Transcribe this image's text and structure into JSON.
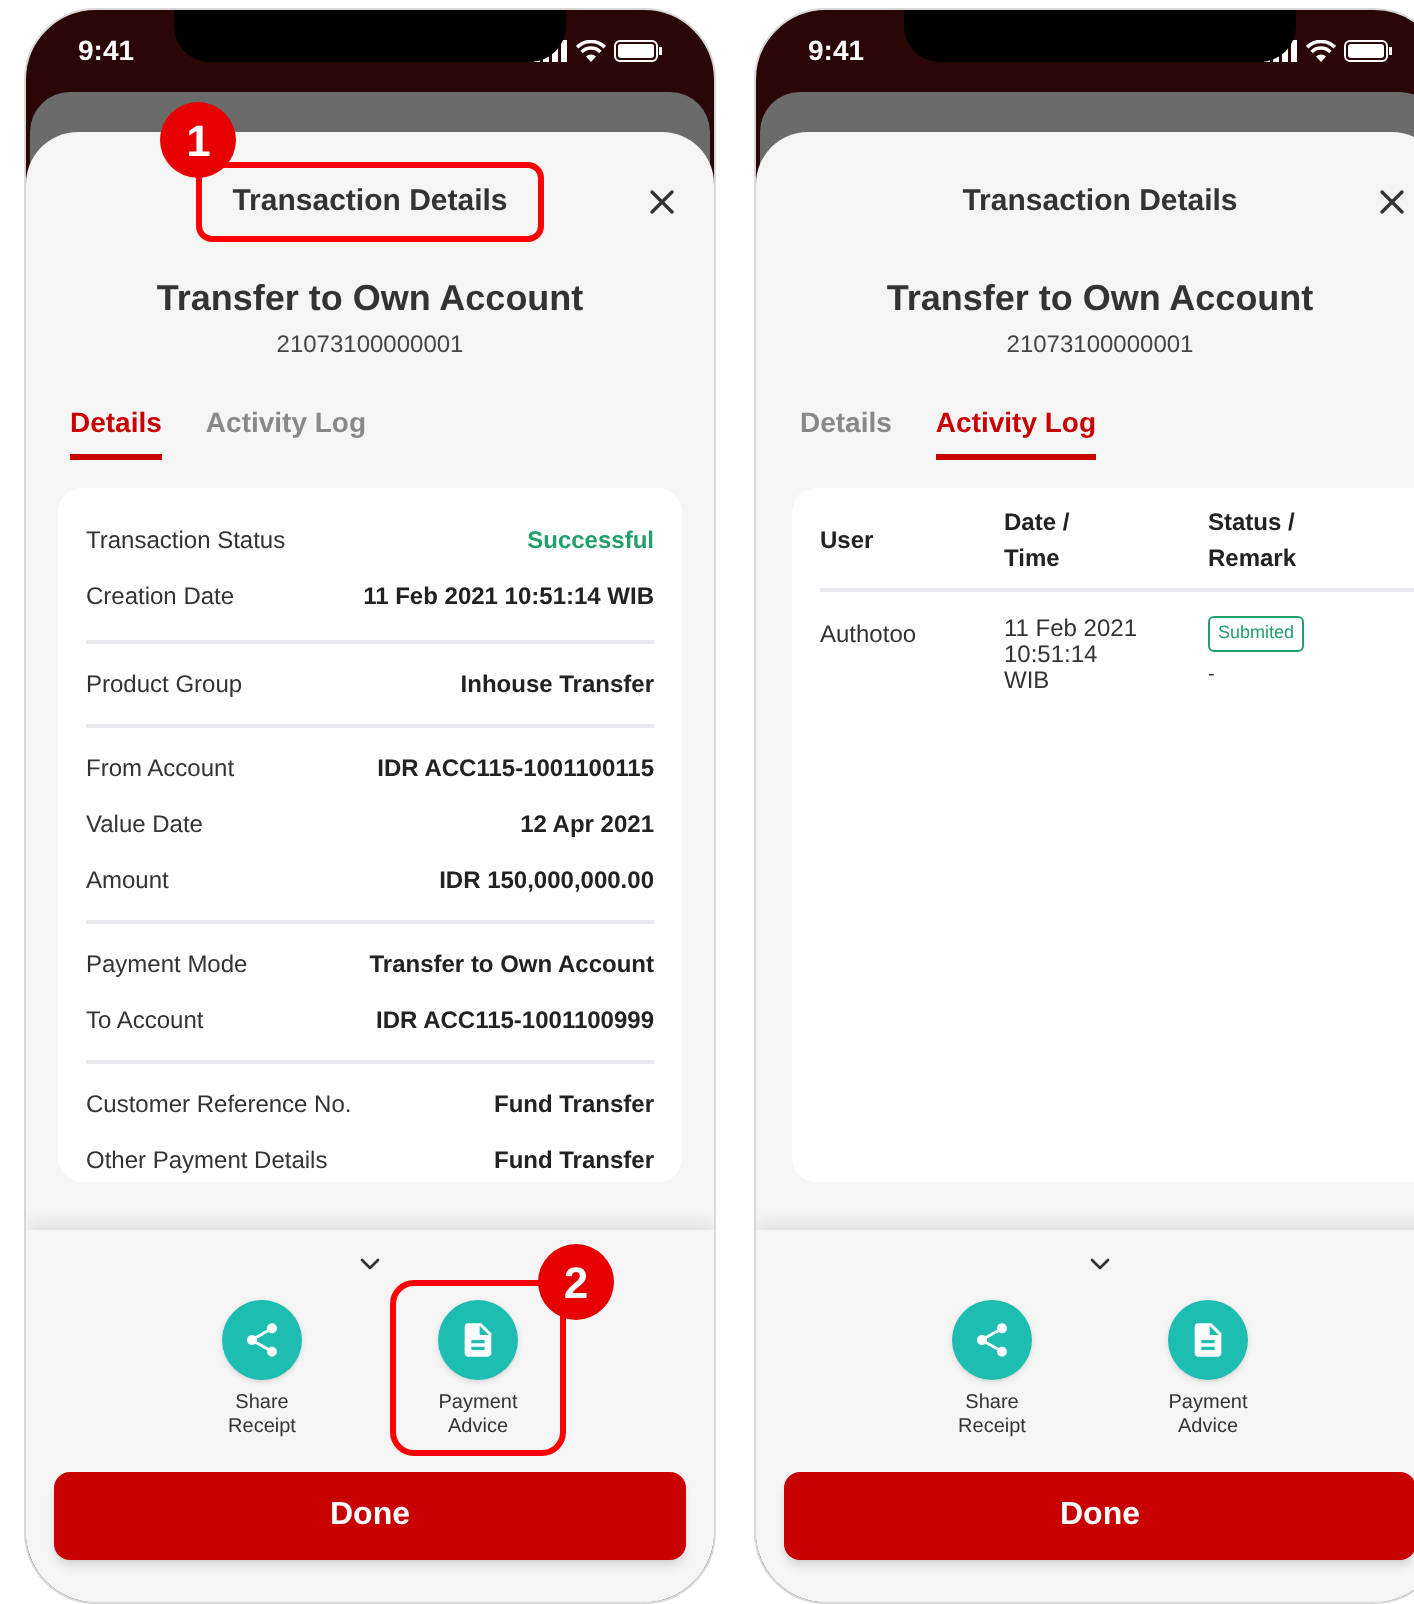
{
  "screens": [
    {
      "status_bar": {
        "time": "9:41"
      },
      "title": "Transaction Details",
      "title_callout": "1",
      "heading": "Transfer to Own Account",
      "reference": "21073100000001",
      "tabs": [
        {
          "label": "Details",
          "selected": true
        },
        {
          "label": "Activity Log",
          "selected": false
        }
      ],
      "content": {
        "kind": "details",
        "groups": [
          [
            {
              "label": "Transaction Status",
              "value": "Successful",
              "kind": "status"
            },
            {
              "label": "Creation Date",
              "value": "11 Feb 2021 10:51:14 WIB",
              "kind": "text"
            }
          ],
          [
            {
              "label": "Product Group",
              "value": "Inhouse Transfer",
              "kind": "text"
            }
          ],
          [
            {
              "label": "From Account",
              "value": "IDR ACC115-1001100115",
              "kind": "text"
            },
            {
              "label": "Value Date",
              "value": "12 Apr 2021",
              "kind": "text"
            },
            {
              "label": "Amount",
              "value": "IDR 150,000,000.00",
              "kind": "text"
            }
          ],
          [
            {
              "label": "Payment Mode",
              "value": "Transfer to Own Account",
              "kind": "text"
            },
            {
              "label": "To Account",
              "value": "IDR ACC115-1001100999",
              "kind": "text"
            }
          ],
          [
            {
              "label": "Customer Reference No.",
              "value": "Fund Transfer",
              "kind": "text"
            },
            {
              "label": "Other Payment Details",
              "value": "Fund Transfer",
              "kind": "text"
            }
          ]
        ]
      },
      "actions": [
        {
          "kind": "share",
          "label": "Share Receipt"
        },
        {
          "kind": "document",
          "label": "Payment Advice",
          "callout": "2"
        }
      ],
      "done": "Done"
    },
    {
      "status_bar": {
        "time": "9:41"
      },
      "title": "Transaction Details",
      "heading": "Transfer to Own Account",
      "reference": "21073100000001",
      "tabs": [
        {
          "label": "Details",
          "selected": false
        },
        {
          "label": "Activity Log",
          "selected": true
        }
      ],
      "content": {
        "kind": "activity_log",
        "columns": [
          "User",
          "Date / Time",
          "Status / Remark"
        ],
        "rows": [
          {
            "user": "Authotoo",
            "date_time": "11 Feb 2021 10:51:14 WIB",
            "status": "Submited",
            "remark": "-"
          }
        ]
      },
      "actions": [
        {
          "kind": "share",
          "label": "Share Receipt"
        },
        {
          "kind": "document",
          "label": "Payment Advice"
        }
      ],
      "done": "Done"
    }
  ]
}
